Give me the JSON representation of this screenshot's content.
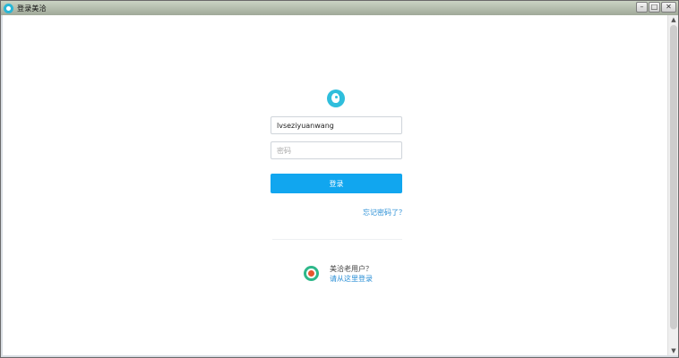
{
  "window": {
    "title": "登录美洽",
    "controls": {
      "minimize": "–",
      "maximize": "□",
      "close": "✕"
    }
  },
  "login": {
    "username_value": "lvseziyuanwang",
    "password_placeholder": "密码",
    "submit_label": "登录",
    "forgot_label": "忘记密码了？"
  },
  "alt_login": {
    "question": "美洽老用户？",
    "link_label": "请从这里登录"
  },
  "scrollbar": {
    "up_arrow": "▲",
    "down_arrow": "▼"
  },
  "colors": {
    "brand_blue": "#11a6ef",
    "logo_teal": "#2fbedc",
    "link_blue": "#2a8fd6",
    "alt_green": "#2eb88a"
  },
  "icons": {
    "app": "meiqia-app-icon",
    "logo": "meiqia-bird-logo-icon",
    "alt": "old-meiqia-logo-icon"
  }
}
